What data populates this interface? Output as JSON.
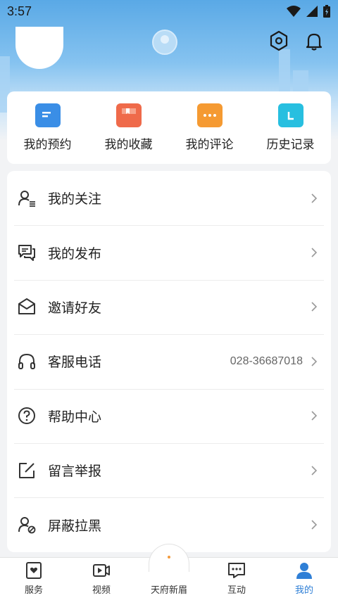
{
  "status": {
    "time": "3:57"
  },
  "shortcuts": [
    {
      "label": "我的预约",
      "icon": "calendar-icon",
      "color": "#3a8ee6"
    },
    {
      "label": "我的收藏",
      "icon": "bookmark-icon",
      "color": "#ef6a4a"
    },
    {
      "label": "我的评论",
      "icon": "comment-icon",
      "color": "#f59a32"
    },
    {
      "label": "历史记录",
      "icon": "history-icon",
      "color": "#27bfe0"
    }
  ],
  "menu": [
    {
      "label": "我的关注",
      "icon": "follow-user-icon"
    },
    {
      "label": "我的发布",
      "icon": "chat-bubbles-icon"
    },
    {
      "label": "邀请好友",
      "icon": "envelope-icon"
    },
    {
      "label": "客服电话",
      "icon": "headphones-icon",
      "value": "028-36687018"
    },
    {
      "label": "帮助中心",
      "icon": "question-circle-icon"
    },
    {
      "label": "留言举报",
      "icon": "edit-icon"
    },
    {
      "label": "屏蔽拉黑",
      "icon": "block-user-icon"
    }
  ],
  "nav": [
    {
      "label": "服务",
      "icon": "service-heart-icon"
    },
    {
      "label": "视频",
      "icon": "video-icon"
    },
    {
      "label": "天府新眉",
      "icon": "home-center-icon"
    },
    {
      "label": "互动",
      "icon": "chat-dots-icon"
    },
    {
      "label": "我的",
      "icon": "profile-icon",
      "active": true
    }
  ],
  "colors": {
    "accent": "#2f7fd6",
    "nav_active": "#2f7fd6"
  }
}
